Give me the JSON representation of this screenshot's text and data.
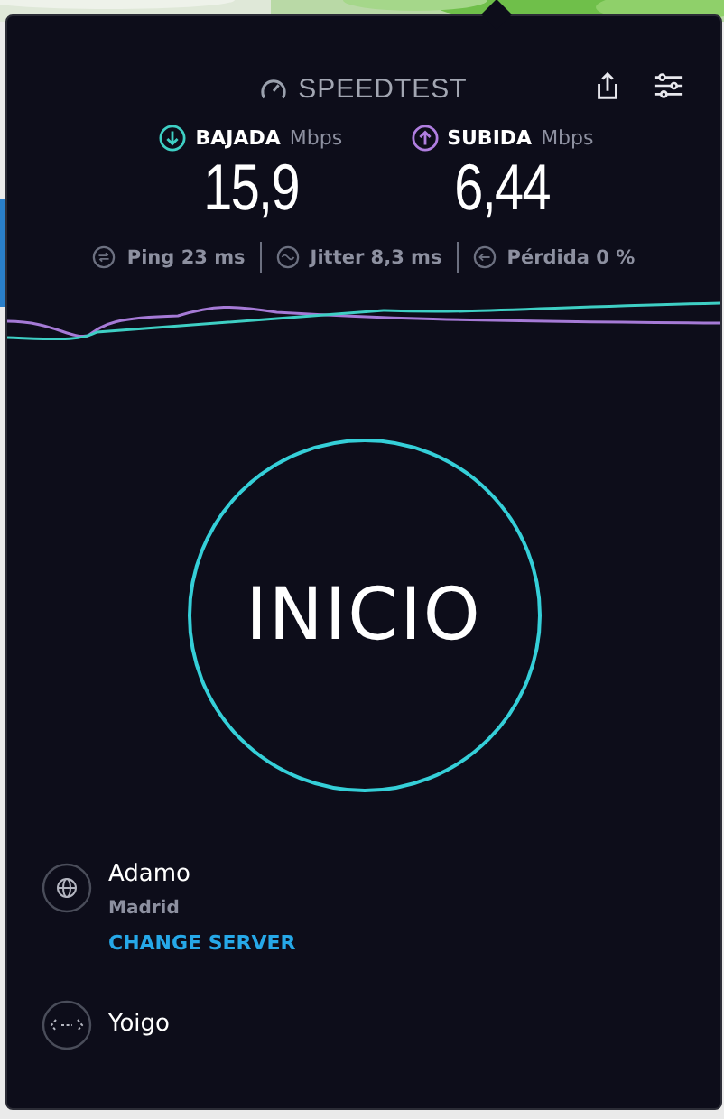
{
  "header": {
    "title": "SPEEDTEST"
  },
  "results": [
    {
      "kind": "download",
      "label": "BAJADA",
      "unit": "Mbps",
      "value": "15,9",
      "color": "#3ecfc4"
    },
    {
      "kind": "upload",
      "label": "SUBIDA",
      "unit": "Mbps",
      "value": "6,44",
      "color": "#b07ee0"
    }
  ],
  "stats": [
    {
      "kind": "ping",
      "text": "Ping 23 ms"
    },
    {
      "kind": "jitter",
      "text": "Jitter 8,3 ms"
    },
    {
      "kind": "loss",
      "text": "Pérdida 0 %"
    }
  ],
  "start_button": {
    "label": "INICIO"
  },
  "server": {
    "name": "Adamo",
    "location": "Madrid",
    "action": "CHANGE SERVER"
  },
  "provider": {
    "name": "Yoigo"
  }
}
